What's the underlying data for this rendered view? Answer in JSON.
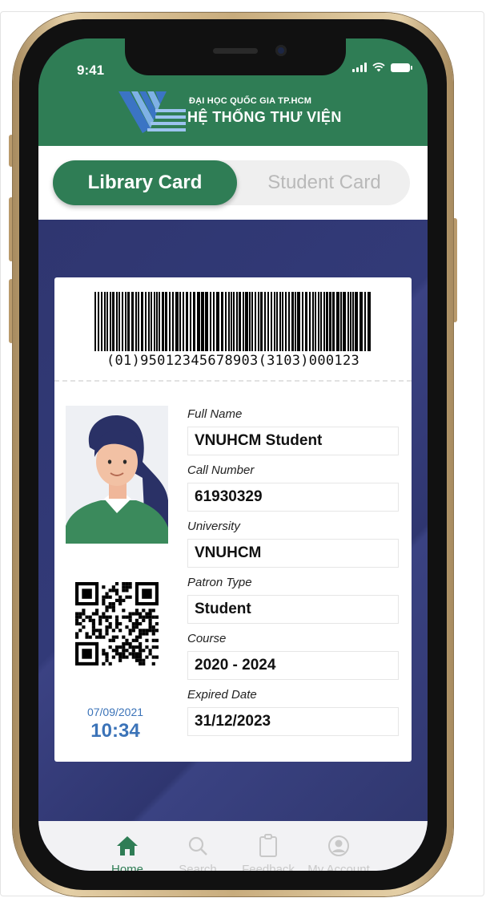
{
  "status_bar": {
    "time": "9:41"
  },
  "header": {
    "org_line1": "ĐẠI HỌC QUỐC GIA TP.HCM",
    "org_line2": "HỆ THỐNG THƯ VIỆN"
  },
  "tabs": [
    {
      "label": "Library Card",
      "active": true
    },
    {
      "label": "Student Card",
      "active": false
    }
  ],
  "card": {
    "barcode_text": "(01)95012345678903(3103)000123",
    "date": "07/09/2021",
    "time": "10:34",
    "fields": [
      {
        "label": "Full Name",
        "value": "VNUHCM Student"
      },
      {
        "label": "Call Number",
        "value": "61930329"
      },
      {
        "label": "University",
        "value": "VNUHCM"
      },
      {
        "label": "Patron Type",
        "value": "Student"
      },
      {
        "label": "Course",
        "value": "2020 - 2024"
      },
      {
        "label": "Expired Date",
        "value": "31/12/2023"
      }
    ]
  },
  "bottom_nav": [
    {
      "label": "Home",
      "icon": "home-icon",
      "active": true
    },
    {
      "label": "Search",
      "icon": "search-icon",
      "active": false
    },
    {
      "label": "Feedback",
      "icon": "clipboard-icon",
      "active": false
    },
    {
      "label": "My Account",
      "icon": "account-icon",
      "active": false
    }
  ],
  "colors": {
    "brand_green": "#2f7d55",
    "navy_background": "#2f3670",
    "accent_blue": "#3b73b8",
    "inactive_gray": "#c8c8c8"
  }
}
